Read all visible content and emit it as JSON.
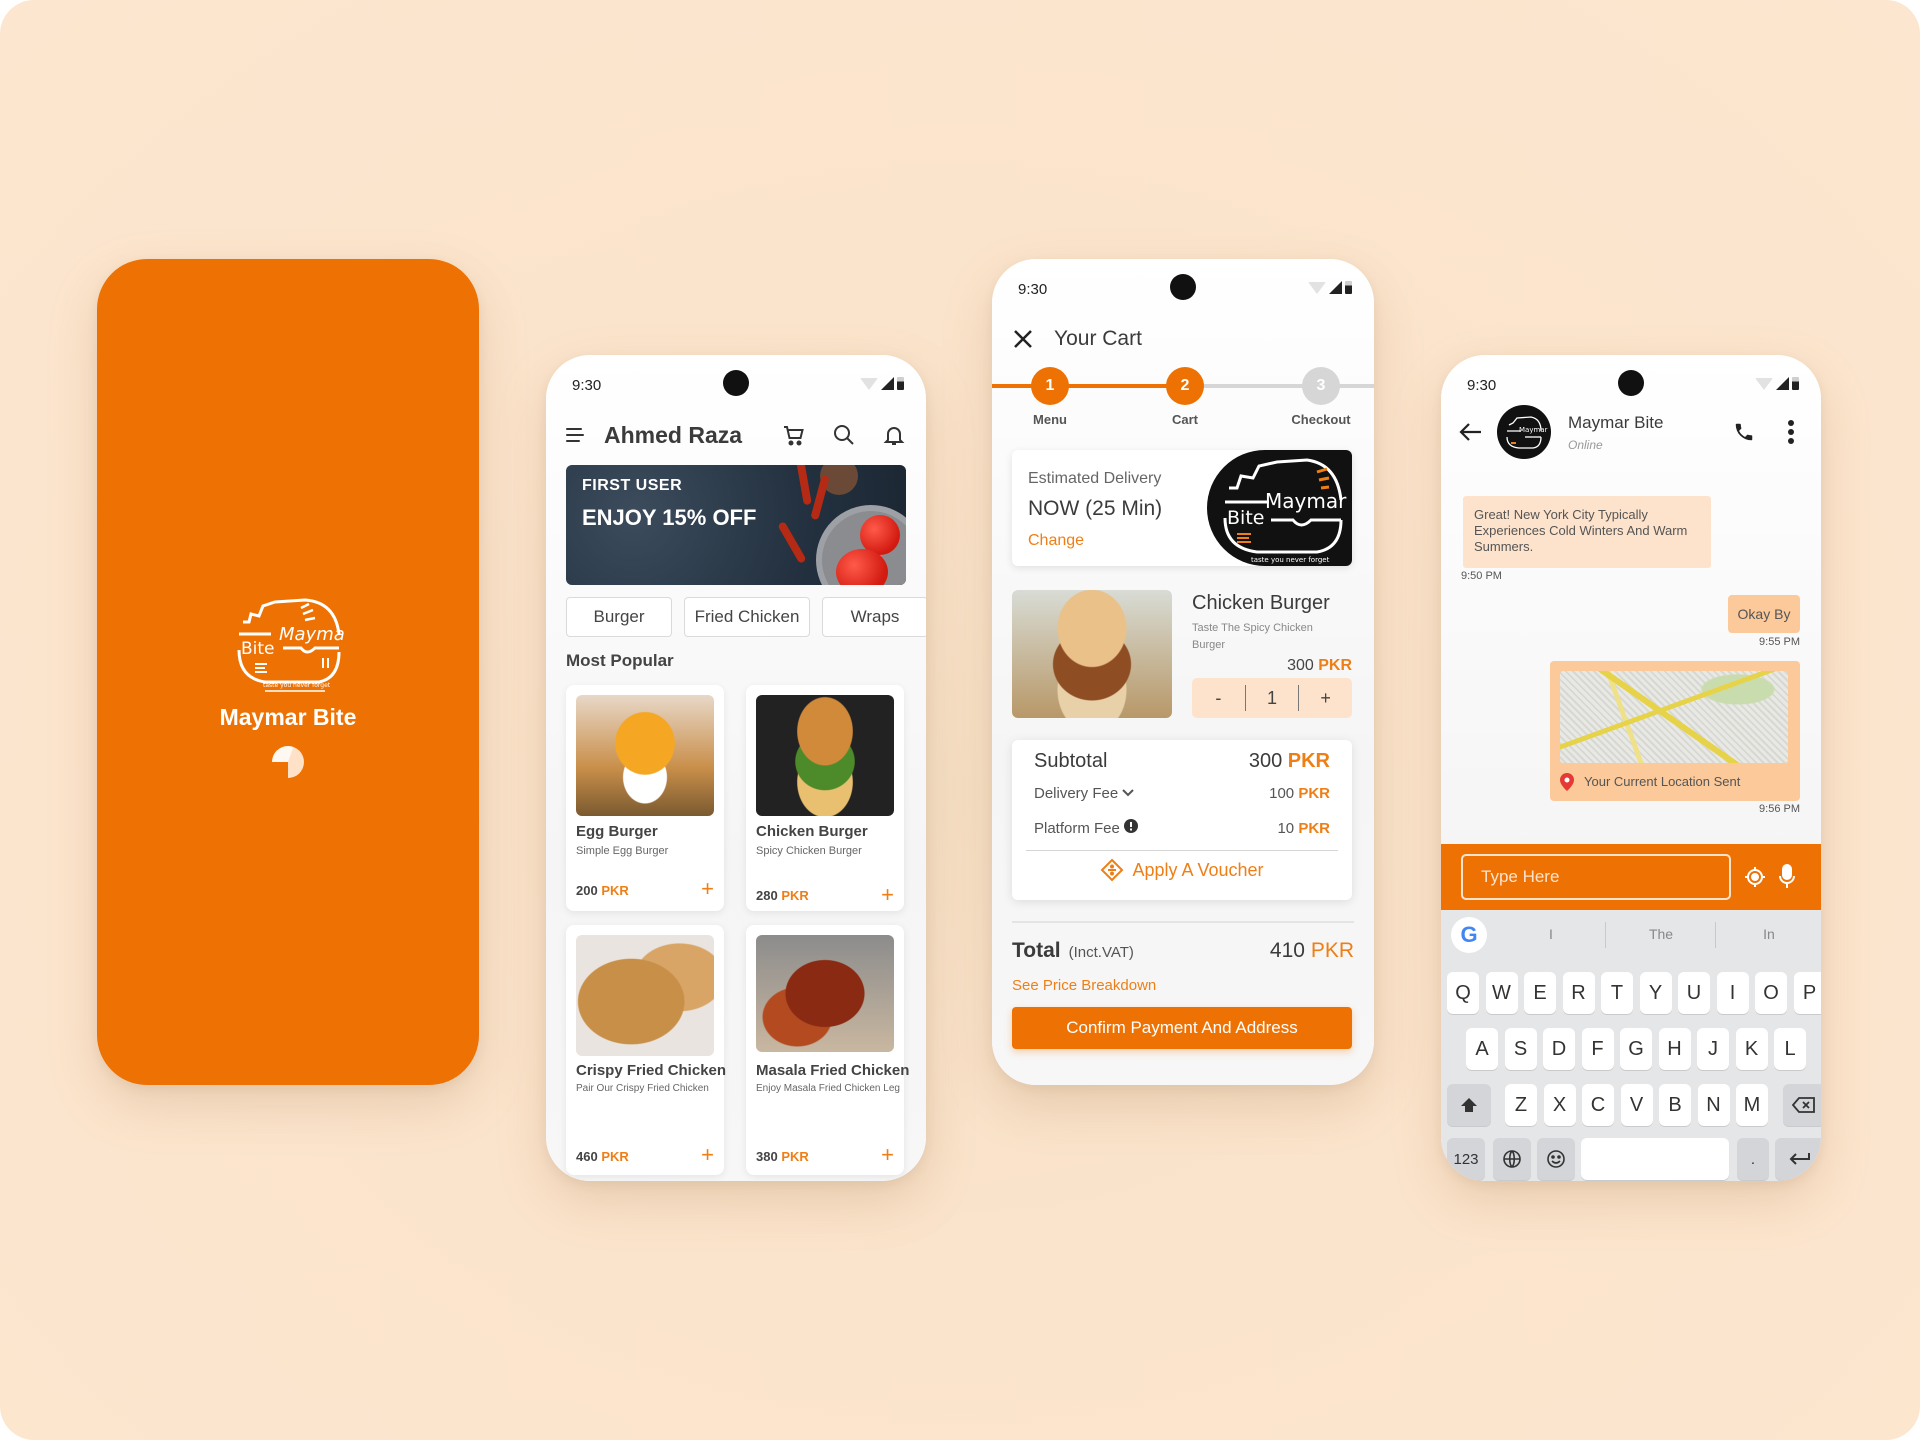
{
  "brand": {
    "name": "Maymar Bite",
    "tagline": "taste you never forget",
    "colors": {
      "primary": "#ee7203",
      "accent": "#ee7f16",
      "background": "#fde6cf",
      "bubble_in": "#fde3cc",
      "bubble_out": "#fbc99a"
    }
  },
  "splash": {
    "title": "Maymar Bite",
    "logo_text_1": "Maymar",
    "logo_text_2": "Bite",
    "loader_icon": "spinner-icon"
  },
  "status_bar": {
    "time": "9:30",
    "icons": [
      "wifi-icon",
      "signal-icon",
      "battery-icon"
    ]
  },
  "menu_screen": {
    "user_name": "Ahmed Raza",
    "header_icons": [
      "menu-icon",
      "cart-icon",
      "search-icon",
      "bell-icon"
    ],
    "banner": {
      "line1": "FIRST USER",
      "line2": "ENJOY 15% OFF"
    },
    "categories": [
      "Burger",
      "Fried Chicken",
      "Wraps"
    ],
    "section_title": "Most Popular",
    "currency": "PKR",
    "items": [
      {
        "name": "Egg Burger",
        "desc": "Simple Egg Burger",
        "price": "200"
      },
      {
        "name": "Chicken Burger",
        "desc": "Spicy Chicken Burger",
        "price": "280"
      },
      {
        "name": "Crispy Fried Chicken",
        "desc": "Pair Our Crispy Fried Chicken",
        "price": "460"
      },
      {
        "name": "Masala Fried Chicken",
        "desc": "Enjoy Masala Fried Chicken Leg",
        "price": "380"
      }
    ],
    "add_symbol": "+"
  },
  "cart_screen": {
    "title": "Your Cart",
    "close_icon": "close-icon",
    "steps": [
      {
        "num": "1",
        "label": "Menu",
        "state": "done"
      },
      {
        "num": "2",
        "label": "Cart",
        "state": "active"
      },
      {
        "num": "3",
        "label": "Checkout",
        "state": "pending"
      }
    ],
    "delivery": {
      "label": "Estimated Delivery",
      "value": "NOW (25 Min)",
      "change": "Change"
    },
    "item": {
      "name": "Chicken Burger",
      "desc": "Taste The Spicy Chicken Burger",
      "price": "300",
      "currency": "PKR",
      "qty": "1",
      "minus": "-",
      "plus": "+"
    },
    "summary": {
      "subtotal_label": "Subtotal",
      "subtotal": "300",
      "delivery_label": "Delivery Fee",
      "delivery": "100",
      "platform_label": "Platform Fee",
      "platform": "10",
      "currency": "PKR",
      "voucher": "Apply A Voucher"
    },
    "total": {
      "label": "Total",
      "note": "(Inct.VAT)",
      "amount": "410",
      "currency": "PKR"
    },
    "breakdown_link": "See Price Breakdown",
    "confirm_button": "Confirm Payment And Address"
  },
  "chat_screen": {
    "contact_name": "Maymar Bite",
    "contact_status": "Online",
    "header_icons": [
      "back-arrow-icon",
      "phone-icon",
      "more-vertical-icon"
    ],
    "messages": [
      {
        "from": "them",
        "text": "Great! New York City Typically Experiences Cold Winters And Warm Summers.",
        "time": "9:50 PM"
      },
      {
        "from": "me",
        "text": "Okay By",
        "time": "9:55 PM"
      },
      {
        "from": "me",
        "type": "location",
        "text": "Your Current Location Sent",
        "time": "9:56 PM"
      }
    ],
    "input_placeholder": "Type Here",
    "input_icons": [
      "location-target-icon",
      "microphone-icon"
    ],
    "keyboard": {
      "suggestions": [
        "I",
        "The",
        "In"
      ],
      "row1": [
        "Q",
        "W",
        "E",
        "R",
        "T",
        "Y",
        "U",
        "I",
        "O",
        "P"
      ],
      "row2": [
        "A",
        "S",
        "D",
        "F",
        "G",
        "H",
        "J",
        "K",
        "L"
      ],
      "row3": [
        "Z",
        "X",
        "C",
        "V",
        "B",
        "N",
        "M"
      ],
      "numbers_key": "123",
      "period_key": "."
    }
  }
}
